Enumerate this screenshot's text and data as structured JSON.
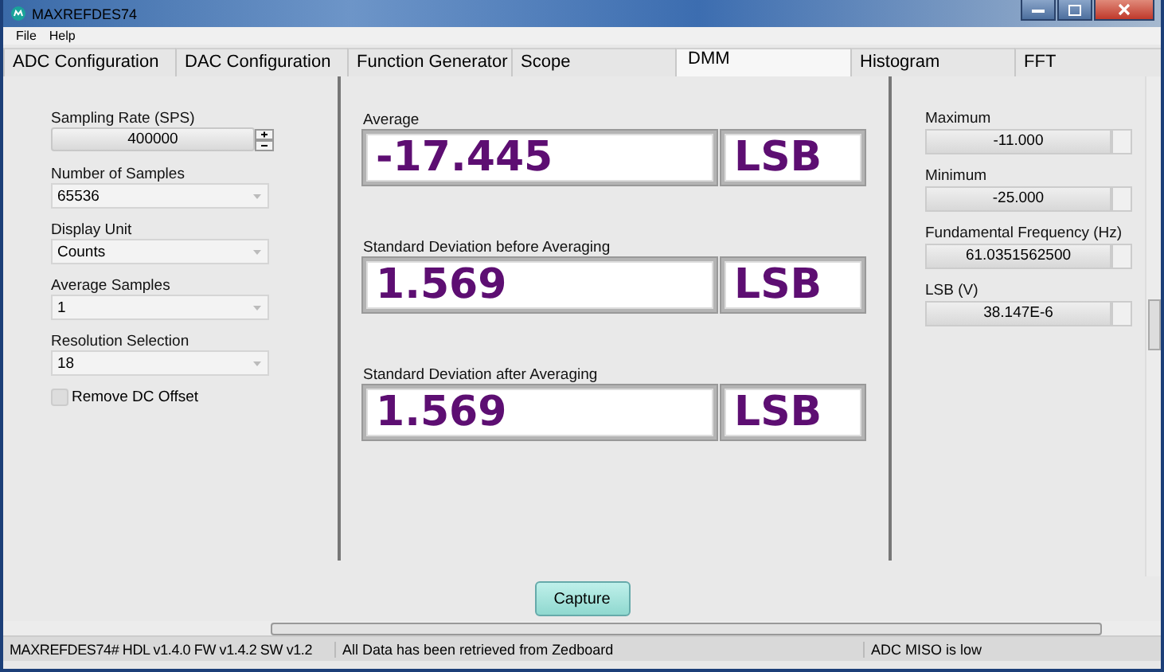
{
  "window": {
    "title": "MAXREFDES74"
  },
  "menu": [
    "File",
    "Help"
  ],
  "tabs": [
    {
      "label": "ADC Configuration",
      "selected": false
    },
    {
      "label": "DAC Configuration",
      "selected": false
    },
    {
      "label": "Function Generator",
      "selected": false
    },
    {
      "label": "Scope",
      "selected": false
    },
    {
      "label": "DMM",
      "selected": true
    },
    {
      "label": "Histogram",
      "selected": false
    },
    {
      "label": "FFT",
      "selected": false
    }
  ],
  "settings": {
    "sampling_rate": {
      "label": "Sampling Rate (SPS)",
      "value": "400000"
    },
    "selects": [
      {
        "label": "Number of Samples",
        "value": "65536"
      },
      {
        "label": "Display Unit",
        "value": "Counts"
      },
      {
        "label": "Average Samples",
        "value": "1"
      },
      {
        "label": "Resolution Selection",
        "value": "18"
      }
    ],
    "remove_dc_offset": {
      "label": "Remove DC Offset",
      "checked": false
    }
  },
  "readings": [
    {
      "label": "Average",
      "value": "-17.445",
      "unit": "LSB"
    },
    {
      "label": "Standard Deviation before Averaging",
      "value": "1.569",
      "unit": "LSB"
    },
    {
      "label": "Standard Deviation after Averaging",
      "value": "1.569",
      "unit": "LSB"
    }
  ],
  "stats": [
    {
      "label": "Maximum",
      "value": "-11.000"
    },
    {
      "label": "Minimum",
      "value": "-25.000"
    },
    {
      "label": "Fundamental Frequency (Hz)",
      "value": "61.0351562500"
    },
    {
      "label": "LSB (V)",
      "value": "38.147E-6"
    }
  ],
  "capture_button": "Capture",
  "status_bar": [
    "MAXREFDES74# HDL v1.4.0 FW v1.4.2 SW v1.2",
    "All Data has been retrieved from Zedboard",
    "ADC MISO is low"
  ]
}
